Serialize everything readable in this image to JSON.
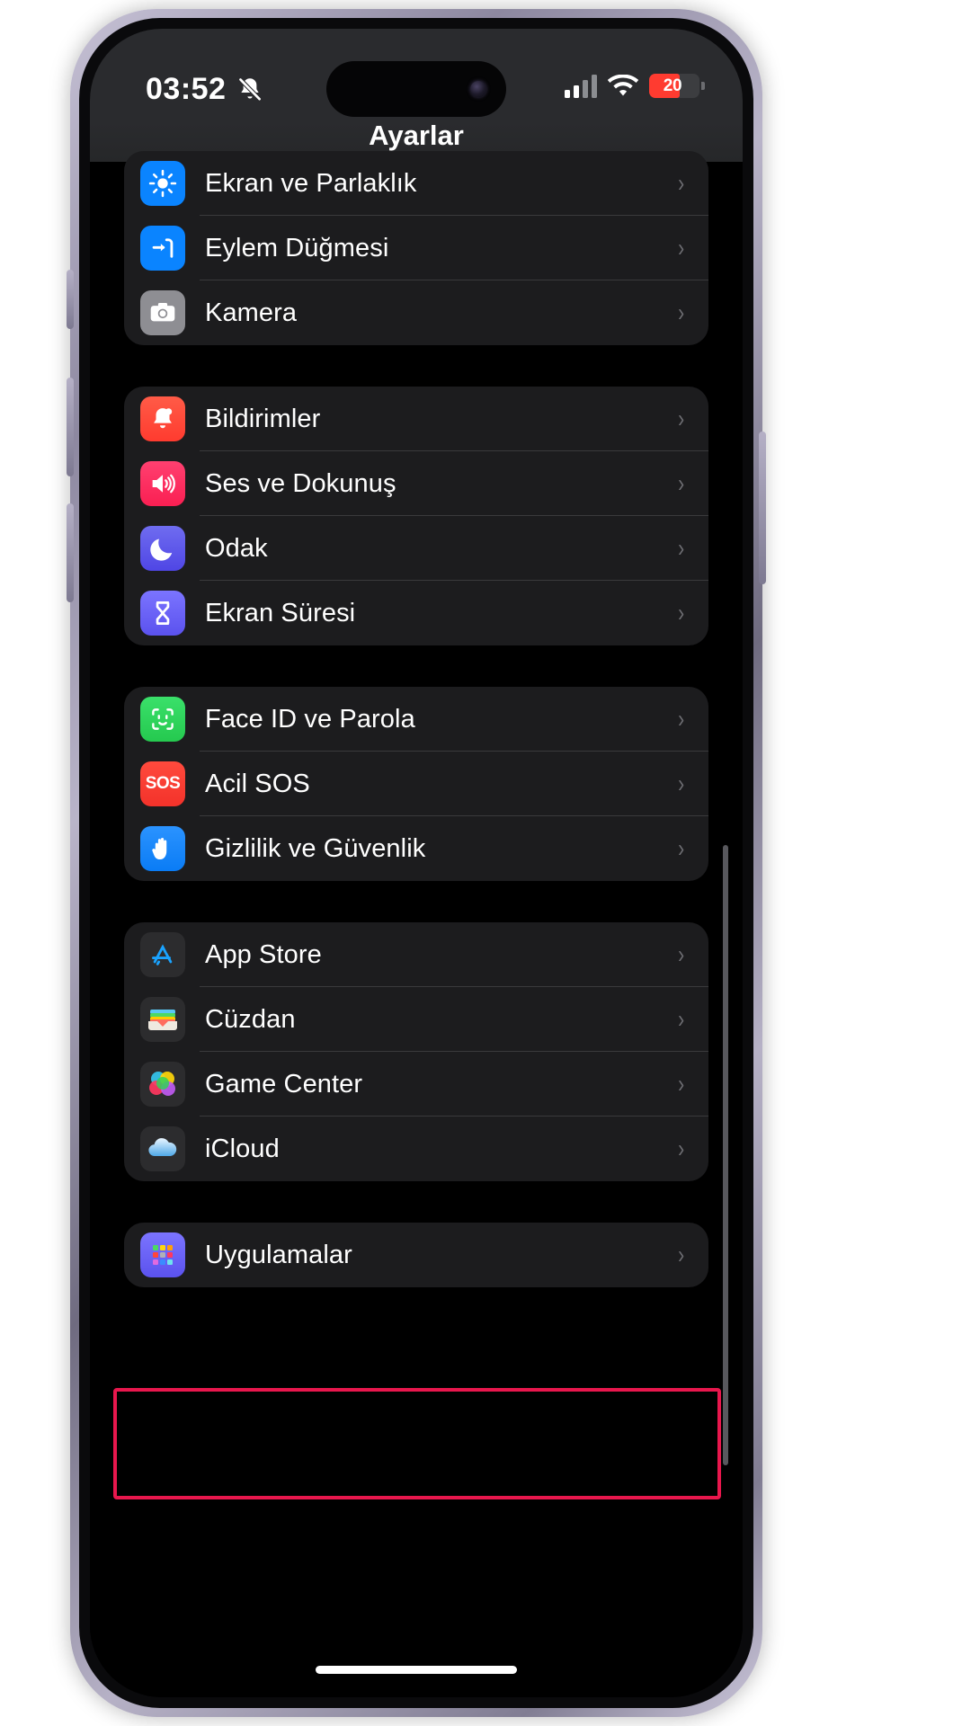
{
  "status_bar": {
    "time": "03:52",
    "silent_icon": "bell-slash-icon",
    "signal_icon": "cellular-signal-icon",
    "signal_bars_filled": 2,
    "signal_bars_total": 4,
    "wifi_icon": "wifi-icon",
    "battery_percent": "20",
    "battery_color": "#ff3b30"
  },
  "nav": {
    "title": "Ayarlar"
  },
  "groups": [
    {
      "id": "display-group",
      "rows": [
        {
          "label": "Ekran ve Parlaklık",
          "icon": "brightness-icon",
          "icon_color": "#0a84ff",
          "chevron": "›"
        },
        {
          "label": "Eylem Düğmesi",
          "icon": "action-button-icon",
          "icon_color": "#0a84ff",
          "chevron": "›"
        },
        {
          "label": "Kamera",
          "icon": "camera-icon",
          "icon_color": "#8e8e93",
          "chevron": "›"
        }
      ]
    },
    {
      "id": "notifications-group",
      "rows": [
        {
          "label": "Bildirimler",
          "icon": "bell-icon",
          "icon_color": "#ff453a",
          "chevron": "›"
        },
        {
          "label": "Ses ve Dokunuş",
          "icon": "speaker-icon",
          "icon_color": "#ff2d55",
          "chevron": "›"
        },
        {
          "label": "Odak",
          "icon": "moon-icon",
          "icon_color": "#5e5ce6",
          "chevron": "›"
        },
        {
          "label": "Ekran Süresi",
          "icon": "hourglass-icon",
          "icon_color": "#6c63f5",
          "chevron": "›"
        }
      ]
    },
    {
      "id": "security-group",
      "rows": [
        {
          "label": "Face ID ve Parola",
          "icon": "face-id-icon",
          "icon_color": "#30d158",
          "chevron": "›"
        },
        {
          "label": "Acil SOS",
          "icon": "sos-icon",
          "icon_color": "#ff3b30",
          "chevron": "›"
        },
        {
          "label": "Gizlilik ve Güvenlik",
          "icon": "hand-raised-icon",
          "icon_color": "#0a84ff",
          "chevron": "›"
        }
      ]
    },
    {
      "id": "services-group",
      "rows": [
        {
          "label": "App Store",
          "icon": "app-store-icon",
          "icon_color": "#2c2c2e",
          "chevron": "›"
        },
        {
          "label": "Cüzdan",
          "icon": "wallet-icon",
          "icon_color": "#2c2c2e",
          "chevron": "›"
        },
        {
          "label": "Game Center",
          "icon": "game-center-icon",
          "icon_color": "#2c2c2e",
          "chevron": "›"
        },
        {
          "label": "iCloud",
          "icon": "icloud-icon",
          "icon_color": "#2c2c2e",
          "chevron": "›"
        }
      ]
    },
    {
      "id": "apps-group",
      "rows": [
        {
          "label": "Uygulamalar",
          "icon": "apps-grid-icon",
          "icon_color": "#5e5ce6",
          "chevron": "›"
        }
      ]
    }
  ],
  "annotation": {
    "type": "highlight-rectangle",
    "target": "Uygulamalar",
    "color": "#e8174d"
  }
}
